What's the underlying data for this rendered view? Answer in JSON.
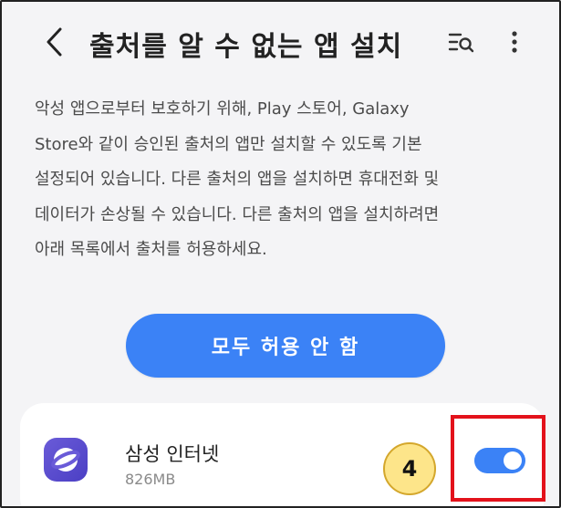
{
  "header": {
    "title": "출처를 알 수 없는 앱 설치"
  },
  "description": {
    "lines": [
      "악성 앱으로부터 보호하기 위해, Play 스토어, Galaxy",
      "Store와 같이 승인된 출처의 앱만 설치할 수 있도록 기본",
      "설정되어 있습니다. 다른 출처의 앱을 설치하면 휴대전화 및",
      "데이터가 손상될 수 있습니다. 다른 출처의 앱을 설치하려면",
      "아래 목록에서 출처를 허용하세요."
    ]
  },
  "allow_all_button": {
    "label": "모두 허용 안 함"
  },
  "app_item": {
    "name": "삼성 인터넷",
    "size": "826MB",
    "toggle_on": true
  },
  "annotation": {
    "badge_number": "4",
    "highlight_color": "#e3121b",
    "badge_color": "#fde58a"
  },
  "colors": {
    "accent": "#3b82f6",
    "background": "#f4f4f6",
    "card": "#ffffff"
  },
  "icons": {
    "back": "chevron-left-icon",
    "search_list": "search-list-icon",
    "more": "more-vertical-icon",
    "app": "samsung-internet-icon"
  }
}
